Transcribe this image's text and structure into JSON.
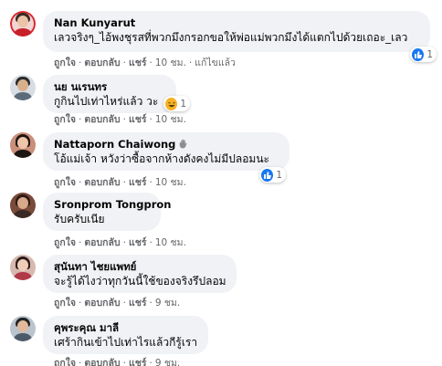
{
  "actions": {
    "like": "ถูกใจ",
    "reply": "ตอบกลับ",
    "share": "แชร์",
    "separator": "·"
  },
  "colors": {
    "bubble": "#f0f2f5",
    "meta_text": "#65676b",
    "like_blue": "#1877f2",
    "haha_yellow": "#f7b125"
  },
  "comments": [
    {
      "author": "Nan Kunyarut",
      "text": "เลวจริงๆ_ไอ้พงชุรสที่พวกมึงกรอกขอให้พ่อแม่พวกมึงได้แตกไปด้วยเถอะ_เลว",
      "time": "10 ชม.",
      "edited": "แก้ไขแล้ว",
      "reaction": {
        "icon": "like-icon",
        "count": "1"
      }
    },
    {
      "author": "นย นเรนทร",
      "text": "กูกินไปเท่าไหร่แล้ว วะ",
      "time": "10 ชม.",
      "reaction": {
        "icon": "haha-icon",
        "count": "1"
      }
    },
    {
      "author": "Nattaporn Chaiwong",
      "author_badge": "hand-wave-icon",
      "text": "โอ้แม่เจ้า หวังว่าซื้อจากห้างดังคงไม่มีปลอมนะ",
      "time": "10 ชม.",
      "reaction": {
        "icon": "like-icon",
        "count": "1"
      }
    },
    {
      "author": "Sronprom Tongpron",
      "text": "รับครับเนีย",
      "time": "10 ชม."
    },
    {
      "author": "สุนันทา ไชยแพทย์",
      "text": "จะรู้ได้ไงว่าทุกวันนี้ใช้ของจริงรึปลอม",
      "time": "9 ชม."
    },
    {
      "author": "คุพระคุณ มาลี",
      "text": "เศร้ากินเข้าไปเท่าไรแล้วกีรู้เรา",
      "time": "9 ชม."
    }
  ]
}
